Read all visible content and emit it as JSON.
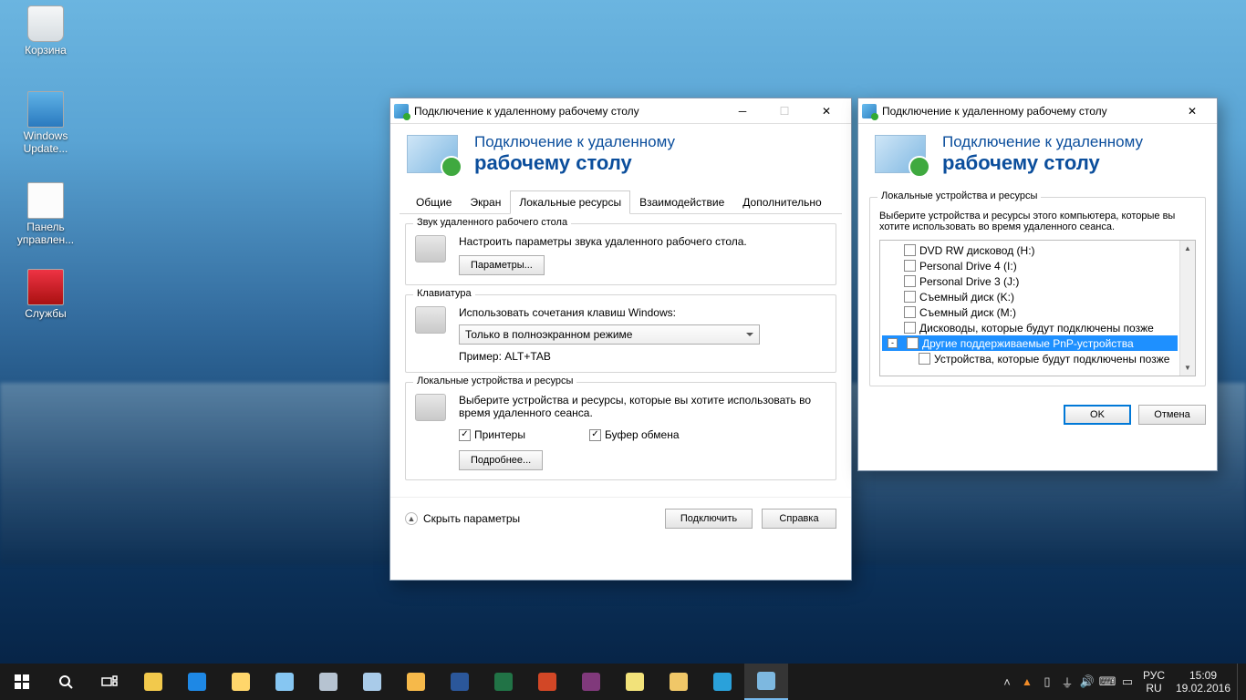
{
  "desktop": {
    "icons": [
      {
        "label": "Корзина",
        "cls": "di-bin"
      },
      {
        "label": "Windows Update...",
        "cls": "di-upd"
      },
      {
        "label": "Панель управлен...",
        "cls": "di-panel"
      },
      {
        "label": "Службы",
        "cls": "di-serv"
      }
    ]
  },
  "win1": {
    "title": "Подключение к удаленному рабочему столу",
    "header_line1": "Подключение к удаленному",
    "header_line2": "рабочему столу",
    "tabs": [
      "Общие",
      "Экран",
      "Локальные ресурсы",
      "Взаимодействие",
      "Дополнительно"
    ],
    "active_tab": 2,
    "group_audio": {
      "legend": "Звук удаленного рабочего стола",
      "desc": "Настроить параметры звука удаленного рабочего стола.",
      "btn": "Параметры..."
    },
    "group_kbd": {
      "legend": "Клавиатура",
      "desc": "Использовать сочетания клавиш Windows:",
      "select": "Только в полноэкранном режиме",
      "hint": "Пример: ALT+TAB"
    },
    "group_local": {
      "legend": "Локальные устройства и ресурсы",
      "desc": "Выберите устройства и ресурсы, которые вы хотите использовать во время удаленного сеанса.",
      "chk_printers": "Принтеры",
      "chk_clip": "Буфер обмена",
      "btn": "Подробнее..."
    },
    "footer": {
      "hide": "Скрыть параметры",
      "connect": "Подключить",
      "help": "Справка"
    }
  },
  "win2": {
    "title": "Подключение к удаленному рабочему столу",
    "header_line1": "Подключение к удаленному",
    "header_line2": "рабочему столу",
    "group_legend": "Локальные устройства и ресурсы",
    "desc": "Выберите устройства и ресурсы этого компьютера, которые вы хотите использовать во время удаленного сеанса.",
    "tree": [
      {
        "label": "DVD RW дисковод (H:)"
      },
      {
        "label": "Personal Drive 4 (I:)"
      },
      {
        "label": "Personal Drive 3 (J:)"
      },
      {
        "label": "Съемный диск (K:)"
      },
      {
        "label": "Съемный диск (M:)"
      },
      {
        "label": "Дисководы, которые будут подключены позже"
      },
      {
        "label": "Другие поддерживаемые PnP-устройства",
        "selected": true,
        "expander": "-"
      },
      {
        "label": "Устройства, которые будут подключены позже",
        "indent": true
      }
    ],
    "ok": "OK",
    "cancel": "Отмена"
  },
  "taskbar": {
    "lang_top": "РУС",
    "lang_bottom": "RU",
    "time": "15:09",
    "date": "19.02.2016",
    "apps": [
      {
        "name": "start",
        "color": "#ffffff"
      },
      {
        "name": "search",
        "color": "#ffffff"
      },
      {
        "name": "taskview",
        "color": "#ffffff"
      },
      {
        "name": "chrome",
        "color": "#f2c94c"
      },
      {
        "name": "ie",
        "color": "#1e88e5"
      },
      {
        "name": "explorer",
        "color": "#ffd66b"
      },
      {
        "name": "calc",
        "color": "#86c6f2"
      },
      {
        "name": "paint",
        "color": "#b6c3d1"
      },
      {
        "name": "magnifier",
        "color": "#a9cbe9"
      },
      {
        "name": "outlook",
        "color": "#f6b94a"
      },
      {
        "name": "word",
        "color": "#2b579a"
      },
      {
        "name": "excel",
        "color": "#217346"
      },
      {
        "name": "powerpoint",
        "color": "#d24726"
      },
      {
        "name": "onenote",
        "color": "#80397b"
      },
      {
        "name": "sticky",
        "color": "#f2e27a"
      },
      {
        "name": "folder",
        "color": "#f0c768"
      },
      {
        "name": "telegram",
        "color": "#2aa1da"
      },
      {
        "name": "mstsc",
        "color": "#7db8e0",
        "active": true
      }
    ]
  }
}
